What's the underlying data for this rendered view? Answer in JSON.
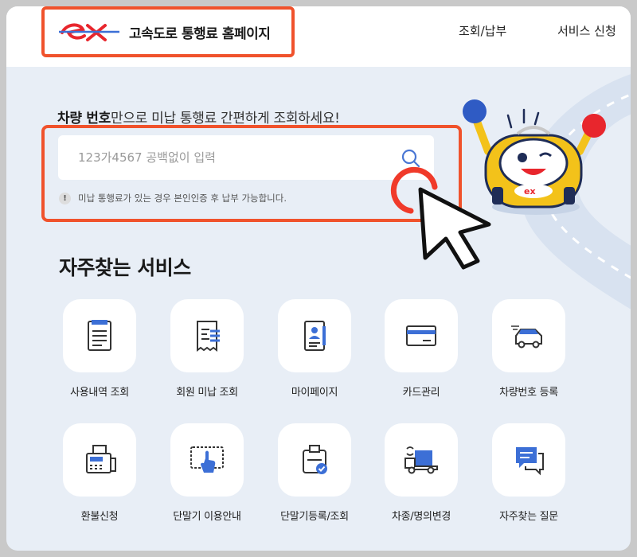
{
  "header": {
    "logo_text": "고속도로 통행료 홈페이지",
    "nav": [
      {
        "label": "조회/납부"
      },
      {
        "label": "서비스 신청"
      }
    ]
  },
  "hero": {
    "title_bold": "차량 번호",
    "title_rest": "만으로 미납 통행료 간편하게 조회하세요!",
    "search_placeholder": "123가4567 공백없이 입력",
    "notice_icon": "!",
    "notice": "미납 통행료가 있는 경우 본인인증 후 납부 가능합니다."
  },
  "services": {
    "title": "자주찾는 서비스",
    "items": [
      {
        "label": "사용내역 조회",
        "icon": "document-list-icon"
      },
      {
        "label": "회원 미납 조회",
        "icon": "receipt-icon"
      },
      {
        "label": "마이페이지",
        "icon": "profile-document-icon"
      },
      {
        "label": "카드관리",
        "icon": "card-icon"
      },
      {
        "label": "차량번호 등록",
        "icon": "car-icon"
      },
      {
        "label": "환불신청",
        "icon": "fax-machine-icon"
      },
      {
        "label": "단말기 이용안내",
        "icon": "touch-screen-icon"
      },
      {
        "label": "단말기등록/조회",
        "icon": "device-check-icon"
      },
      {
        "label": "차종/명의변경",
        "icon": "truck-icon"
      },
      {
        "label": "자주찾는 질문",
        "icon": "chat-icon"
      }
    ]
  },
  "colors": {
    "accent": "#f0522c",
    "brand_blue": "#3c6fd6",
    "brand_red": "#e8262d",
    "background": "#e8eef6"
  }
}
